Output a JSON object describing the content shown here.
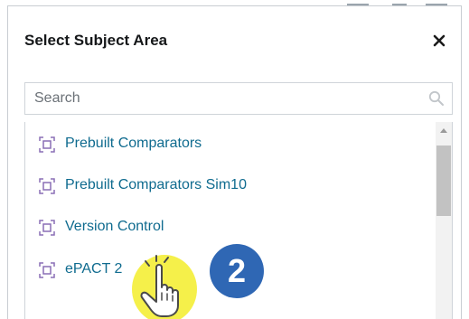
{
  "dialog": {
    "title": "Select Subject Area",
    "close_icon": "close-icon"
  },
  "search": {
    "placeholder": "Search",
    "value": "",
    "icon": "search-icon"
  },
  "subject_areas": [
    {
      "label": "Prebuilt Comparators",
      "icon": "subject-area-icon"
    },
    {
      "label": "Prebuilt Comparators Sim10",
      "icon": "subject-area-icon"
    },
    {
      "label": "Version Control",
      "icon": "subject-area-icon"
    },
    {
      "label": "ePACT 2",
      "icon": "subject-area-icon"
    }
  ],
  "annotation": {
    "step_number": "2",
    "pointer": "hand-pointer-icon",
    "highlight_color": "#f5f04a",
    "badge_color": "#2f67b4"
  },
  "colors": {
    "link": "#0f6b8f",
    "icon": "#8a6fb5",
    "title": "#16181a"
  }
}
